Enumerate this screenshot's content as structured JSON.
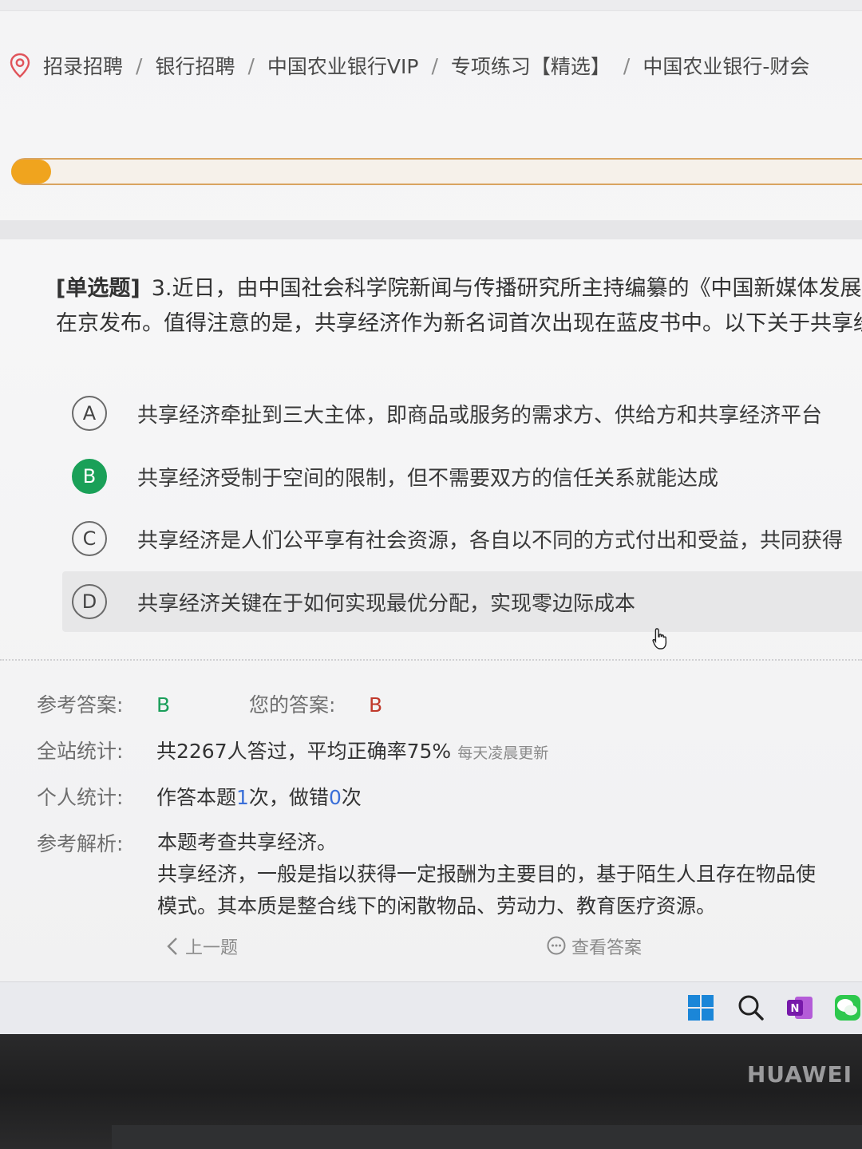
{
  "breadcrumb": {
    "items": [
      "招录招聘",
      "银行招聘",
      "中国农业银行VIP",
      "专项练习【精选】",
      "中国农业银行-财会"
    ],
    "separator": "/"
  },
  "progress": {
    "fraction": 0.05,
    "color": "#f0a41e"
  },
  "question": {
    "type_label": "[单选题]",
    "line1": "3.近日，由中国社会科学院新闻与传播研究所主持编纂的《中国新媒体发展",
    "line2": "在京发布。值得注意的是，共享经济作为新名词首次出现在蓝皮书中。以下关于共享经"
  },
  "options": [
    {
      "letter": "A",
      "text": "共享经济牵扯到三大主体，即商品或服务的需求方、供给方和共享经济平台",
      "selected": false
    },
    {
      "letter": "B",
      "text": "共享经济受制于空间的限制，但不需要双方的信任关系就能达成",
      "selected": true
    },
    {
      "letter": "C",
      "text": "共享经济是人们公平享有社会资源，各自以不同的方式付出和受益，共同获得",
      "selected": false
    },
    {
      "letter": "D",
      "text": "共享经济关键在于如何实现最优分配，实现零边际成本",
      "selected": false
    }
  ],
  "result": {
    "ref_label": "参考答案:",
    "ref_value": "B",
    "your_label": "您的答案:",
    "your_value": "B"
  },
  "site_stats": {
    "label": "全站统计:",
    "text": "共2267人答过，平均正确率75%",
    "note": "每天凌晨更新"
  },
  "personal_stats": {
    "label": "个人统计:",
    "prefix": "作答本题",
    "times": "1",
    "mid": "次，做错",
    "wrong": "0",
    "suffix": "次"
  },
  "analysis": {
    "label": "参考解析:",
    "line1": "本题考查共享经济。",
    "line2": "共享经济，一般是指以获得一定报酬为主要目的，基于陌生人且存在物品使",
    "line3": "模式。其本质是整合线下的闲散物品、劳动力、教育医疗资源。"
  },
  "nav": {
    "prev_label": "上一题",
    "view_answer_label": "查看答案"
  },
  "device": {
    "brand": "HUAWEI"
  },
  "colors": {
    "accent_green": "#1aa058",
    "wrong_red": "#c0392b",
    "highlight_blue": "#3a6fd8"
  }
}
